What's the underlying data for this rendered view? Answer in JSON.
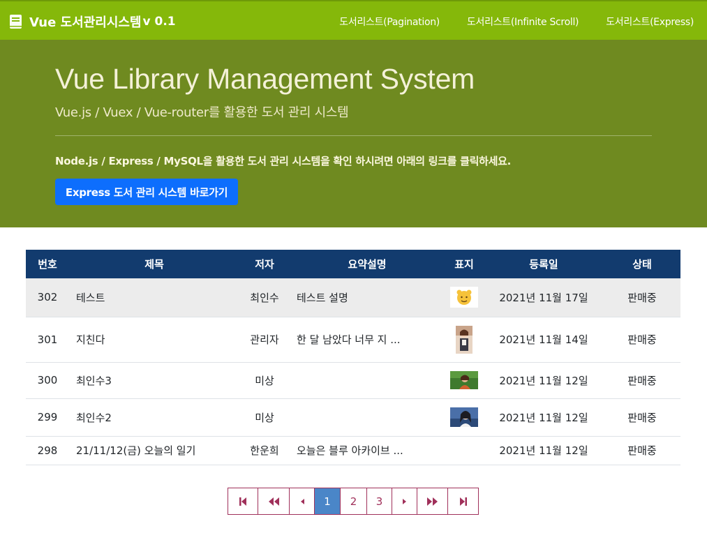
{
  "navbar": {
    "brand": "Vue 도서관리시스템",
    "version": "v 0.1",
    "links": [
      "도서리스트(Pagination)",
      "도서리스트(Infinite Scroll)",
      "도서리스트(Express)"
    ]
  },
  "jumbotron": {
    "title": "Vue Library Management System",
    "subtitle": "Vue.js / Vuex / Vue-router를 활용한 도서 관리 시스템",
    "description": "Node.js / Express / MySQL을 활용한 도서 관리 시스템을 확인 하시려면 아래의 링크를 클릭하세요.",
    "button_label": "Express 도서 관리 시스템 바로가기"
  },
  "table": {
    "headers": [
      "번호",
      "제목",
      "저자",
      "요약설명",
      "표지",
      "등록일",
      "상태"
    ],
    "rows": [
      {
        "no": "302",
        "title": "테스트",
        "author": "최인수",
        "summary": "테스트 설명",
        "cover": "yellow-character-cover",
        "date": "2021년 11월 17일",
        "status": "판매중"
      },
      {
        "no": "301",
        "title": "지친다",
        "author": "관리자",
        "summary": "한 달 남았다 너무 지 ...",
        "cover": "person-photo-cover",
        "date": "2021년 11월 14일",
        "status": "판매중"
      },
      {
        "no": "300",
        "title": "최인수3",
        "author": "미상",
        "summary": "",
        "cover": "green-photo-cover",
        "date": "2021년 11월 12일",
        "status": "판매중"
      },
      {
        "no": "299",
        "title": "최인수2",
        "author": "미상",
        "summary": "",
        "cover": "blue-photo-cover",
        "date": "2021년 11월 12일",
        "status": "판매중"
      },
      {
        "no": "298",
        "title": "21/11/12(금) 오늘의 일기",
        "author": "한운희",
        "summary": "오늘은 블루 아카이브 ...",
        "cover": "",
        "date": "2021년 11월 12일",
        "status": "판매중"
      }
    ]
  },
  "pagination": {
    "pages": [
      "1",
      "2",
      "3"
    ],
    "current": "1",
    "icons": [
      "first-page-icon",
      "prev-ten-icon",
      "prev-page-icon",
      "next-page-icon",
      "next-ten-icon",
      "last-page-icon"
    ]
  },
  "colors": {
    "navbar": "#85b80a",
    "jumbotron": "#6f8a20",
    "table_header": "#123b6e",
    "primary_button": "#0d6efd",
    "pager_accent": "#a0305a",
    "pager_active": "#4a86c8"
  }
}
